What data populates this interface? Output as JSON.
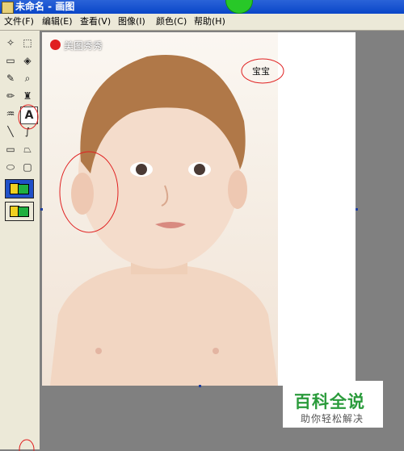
{
  "window": {
    "title": "未命名 - 画图"
  },
  "menu": [
    "文件(F)",
    "编辑(E)",
    "查看(V)",
    "图像(I)",
    "颜色(C)",
    "帮助(H)"
  ],
  "tools": [
    {
      "name": "free-select-tool-icon",
      "glyph": "✧"
    },
    {
      "name": "rect-select-tool-icon",
      "glyph": "⬚"
    },
    {
      "name": "eraser-tool-icon",
      "glyph": "▭"
    },
    {
      "name": "fill-tool-icon",
      "glyph": "◈"
    },
    {
      "name": "color-picker-tool-icon",
      "glyph": "✎"
    },
    {
      "name": "magnifier-tool-icon",
      "glyph": "⌕"
    },
    {
      "name": "pencil-tool-icon",
      "glyph": "✏"
    },
    {
      "name": "brush-tool-icon",
      "glyph": "♜"
    },
    {
      "name": "airbrush-tool-icon",
      "glyph": "♒"
    },
    {
      "name": "text-tool-icon",
      "glyph": "A"
    },
    {
      "name": "line-tool-icon",
      "glyph": "╲"
    },
    {
      "name": "curve-tool-icon",
      "glyph": "∫"
    },
    {
      "name": "rectangle-tool-icon",
      "glyph": "▭"
    },
    {
      "name": "polygon-tool-icon",
      "glyph": "⏢"
    },
    {
      "name": "ellipse-tool-icon",
      "glyph": "⬭"
    },
    {
      "name": "rounded-rectangle-tool-icon",
      "glyph": "▢"
    }
  ],
  "image": {
    "logo_text": "美图秀秀",
    "caption": "宝宝"
  },
  "watermark": {
    "main": "百科全说",
    "sub": "助你轻松解决"
  },
  "colors": {
    "annotation_red": "#e02020",
    "watermark_green": "#2a9b3b",
    "titlebar_blue": "#0a46c8"
  }
}
